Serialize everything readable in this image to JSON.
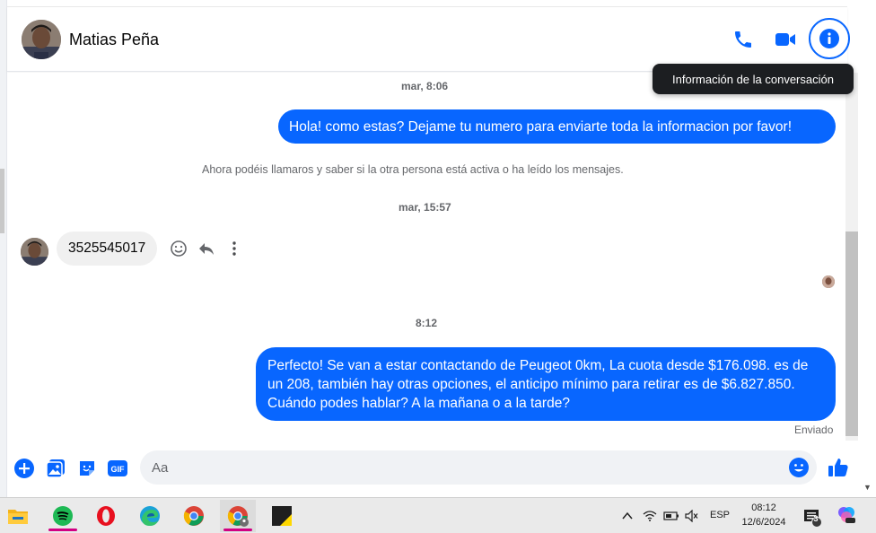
{
  "header": {
    "contact_name": "Matias Peña",
    "tooltip": "Información de la conversación"
  },
  "messages": {
    "ts1": "mar, 8:06",
    "out1": "Hola! como estas? Dejame tu numero para enviarte toda la informacion por favor!",
    "system": "Ahora podéis llamaros y saber si la otra persona está activa o ha leído los mensajes.",
    "ts2": "mar, 15:57",
    "in1": "3525545017",
    "ts3": "8:12",
    "out2": "Perfecto!  Se van a estar contactando de Peugeot 0km, La cuota desde $176.098. es de un 208, también hay otras opciones, el anticipo mínimo para retirar es de $6.827.850. Cuándo podes hablar? A la mañana o a la tarde?",
    "status": "Enviado"
  },
  "composer": {
    "placeholder": "Aa"
  },
  "taskbar": {
    "lang": "ESP",
    "time": "08:12",
    "date": "12/6/2024",
    "notif_count": "3"
  },
  "colors": {
    "accent": "#0866ff",
    "incoming_bubble": "#f0f0f0",
    "tooltip_bg": "#1c1e21"
  }
}
